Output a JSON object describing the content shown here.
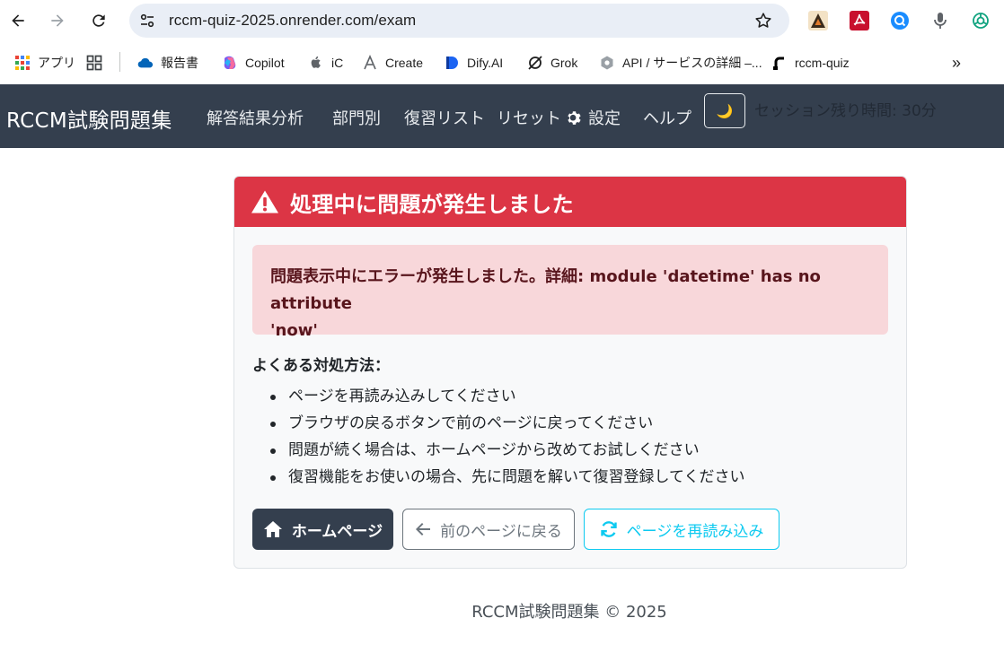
{
  "browser": {
    "url": "rccm-quiz-2025.onrender.com/exam",
    "bookmarks": [
      {
        "label": "アプリ",
        "icon": "apps-grid-icon"
      },
      {
        "label": "",
        "icon": "tab-groups-icon"
      },
      {
        "label": "報告書",
        "icon": "onedrive-cloud-icon"
      },
      {
        "label": "Copilot",
        "icon": "copilot-icon"
      },
      {
        "label": "iC",
        "icon": "apple-icon"
      },
      {
        "label": "Create",
        "icon": "create-icon"
      },
      {
        "label": "Dify.AI",
        "icon": "dify-icon"
      },
      {
        "label": "Grok",
        "icon": "grok-icon"
      },
      {
        "label": "API / サービスの詳細 –...",
        "icon": "gcp-api-icon"
      },
      {
        "label": "rccm-quiz",
        "icon": "render-icon"
      }
    ],
    "overflow": "»"
  },
  "navbar": {
    "brand": "RCCM試験問題集",
    "links": [
      "解答結果分析",
      "部門別",
      "復習リスト",
      "リセット",
      "設定",
      "ヘルプ"
    ],
    "theme_toggle": "🌙",
    "session": "セッション残り時間: 30分"
  },
  "error": {
    "title": "処理中に問題が発生しました",
    "message_line1": "問題表示中にエラーが発生しました。詳細: module 'datetime' has no attribute",
    "message_line2": "'now'",
    "tips_heading": "よくある対処方法：",
    "tips": [
      "ページを再読み込みしてください",
      "ブラウザの戻るボタンで前のページに戻ってください",
      "問題が続く場合は、ホームページから改めてお試しください",
      "復習機能をお使いの場合、先に問題を解いて復習登録してください"
    ],
    "buttons": {
      "home": "ホームページ",
      "back": "前のページに戻る",
      "reload": "ページを再読み込み"
    }
  },
  "footer": "RCCM試験問題集 © 2025",
  "colors": {
    "navbar": "#343f4e",
    "danger": "#dc3545",
    "alert_bg": "#f8d7da",
    "info": "#0dcaf0",
    "secondary": "#6c757d"
  }
}
